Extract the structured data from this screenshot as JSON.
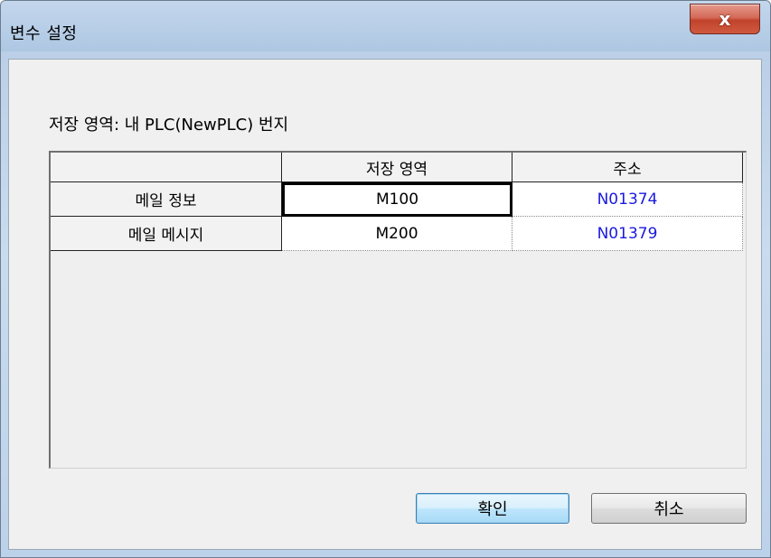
{
  "window": {
    "title": "변수 설정",
    "close_glyph": "x"
  },
  "storage_label": "저장 영역: 내 PLC(NewPLC) 번지",
  "grid": {
    "columns": [
      "",
      "저장 영역",
      "주소"
    ],
    "rows": [
      {
        "label": "메일 정보",
        "storage": "M100",
        "address": "N01374"
      },
      {
        "label": "메일 메시지",
        "storage": "M200",
        "address": "N01379"
      }
    ],
    "selected_row": 0,
    "address_color": "#1a1adf"
  },
  "buttons": {
    "ok_label": "확인",
    "cancel_label": "취소"
  }
}
